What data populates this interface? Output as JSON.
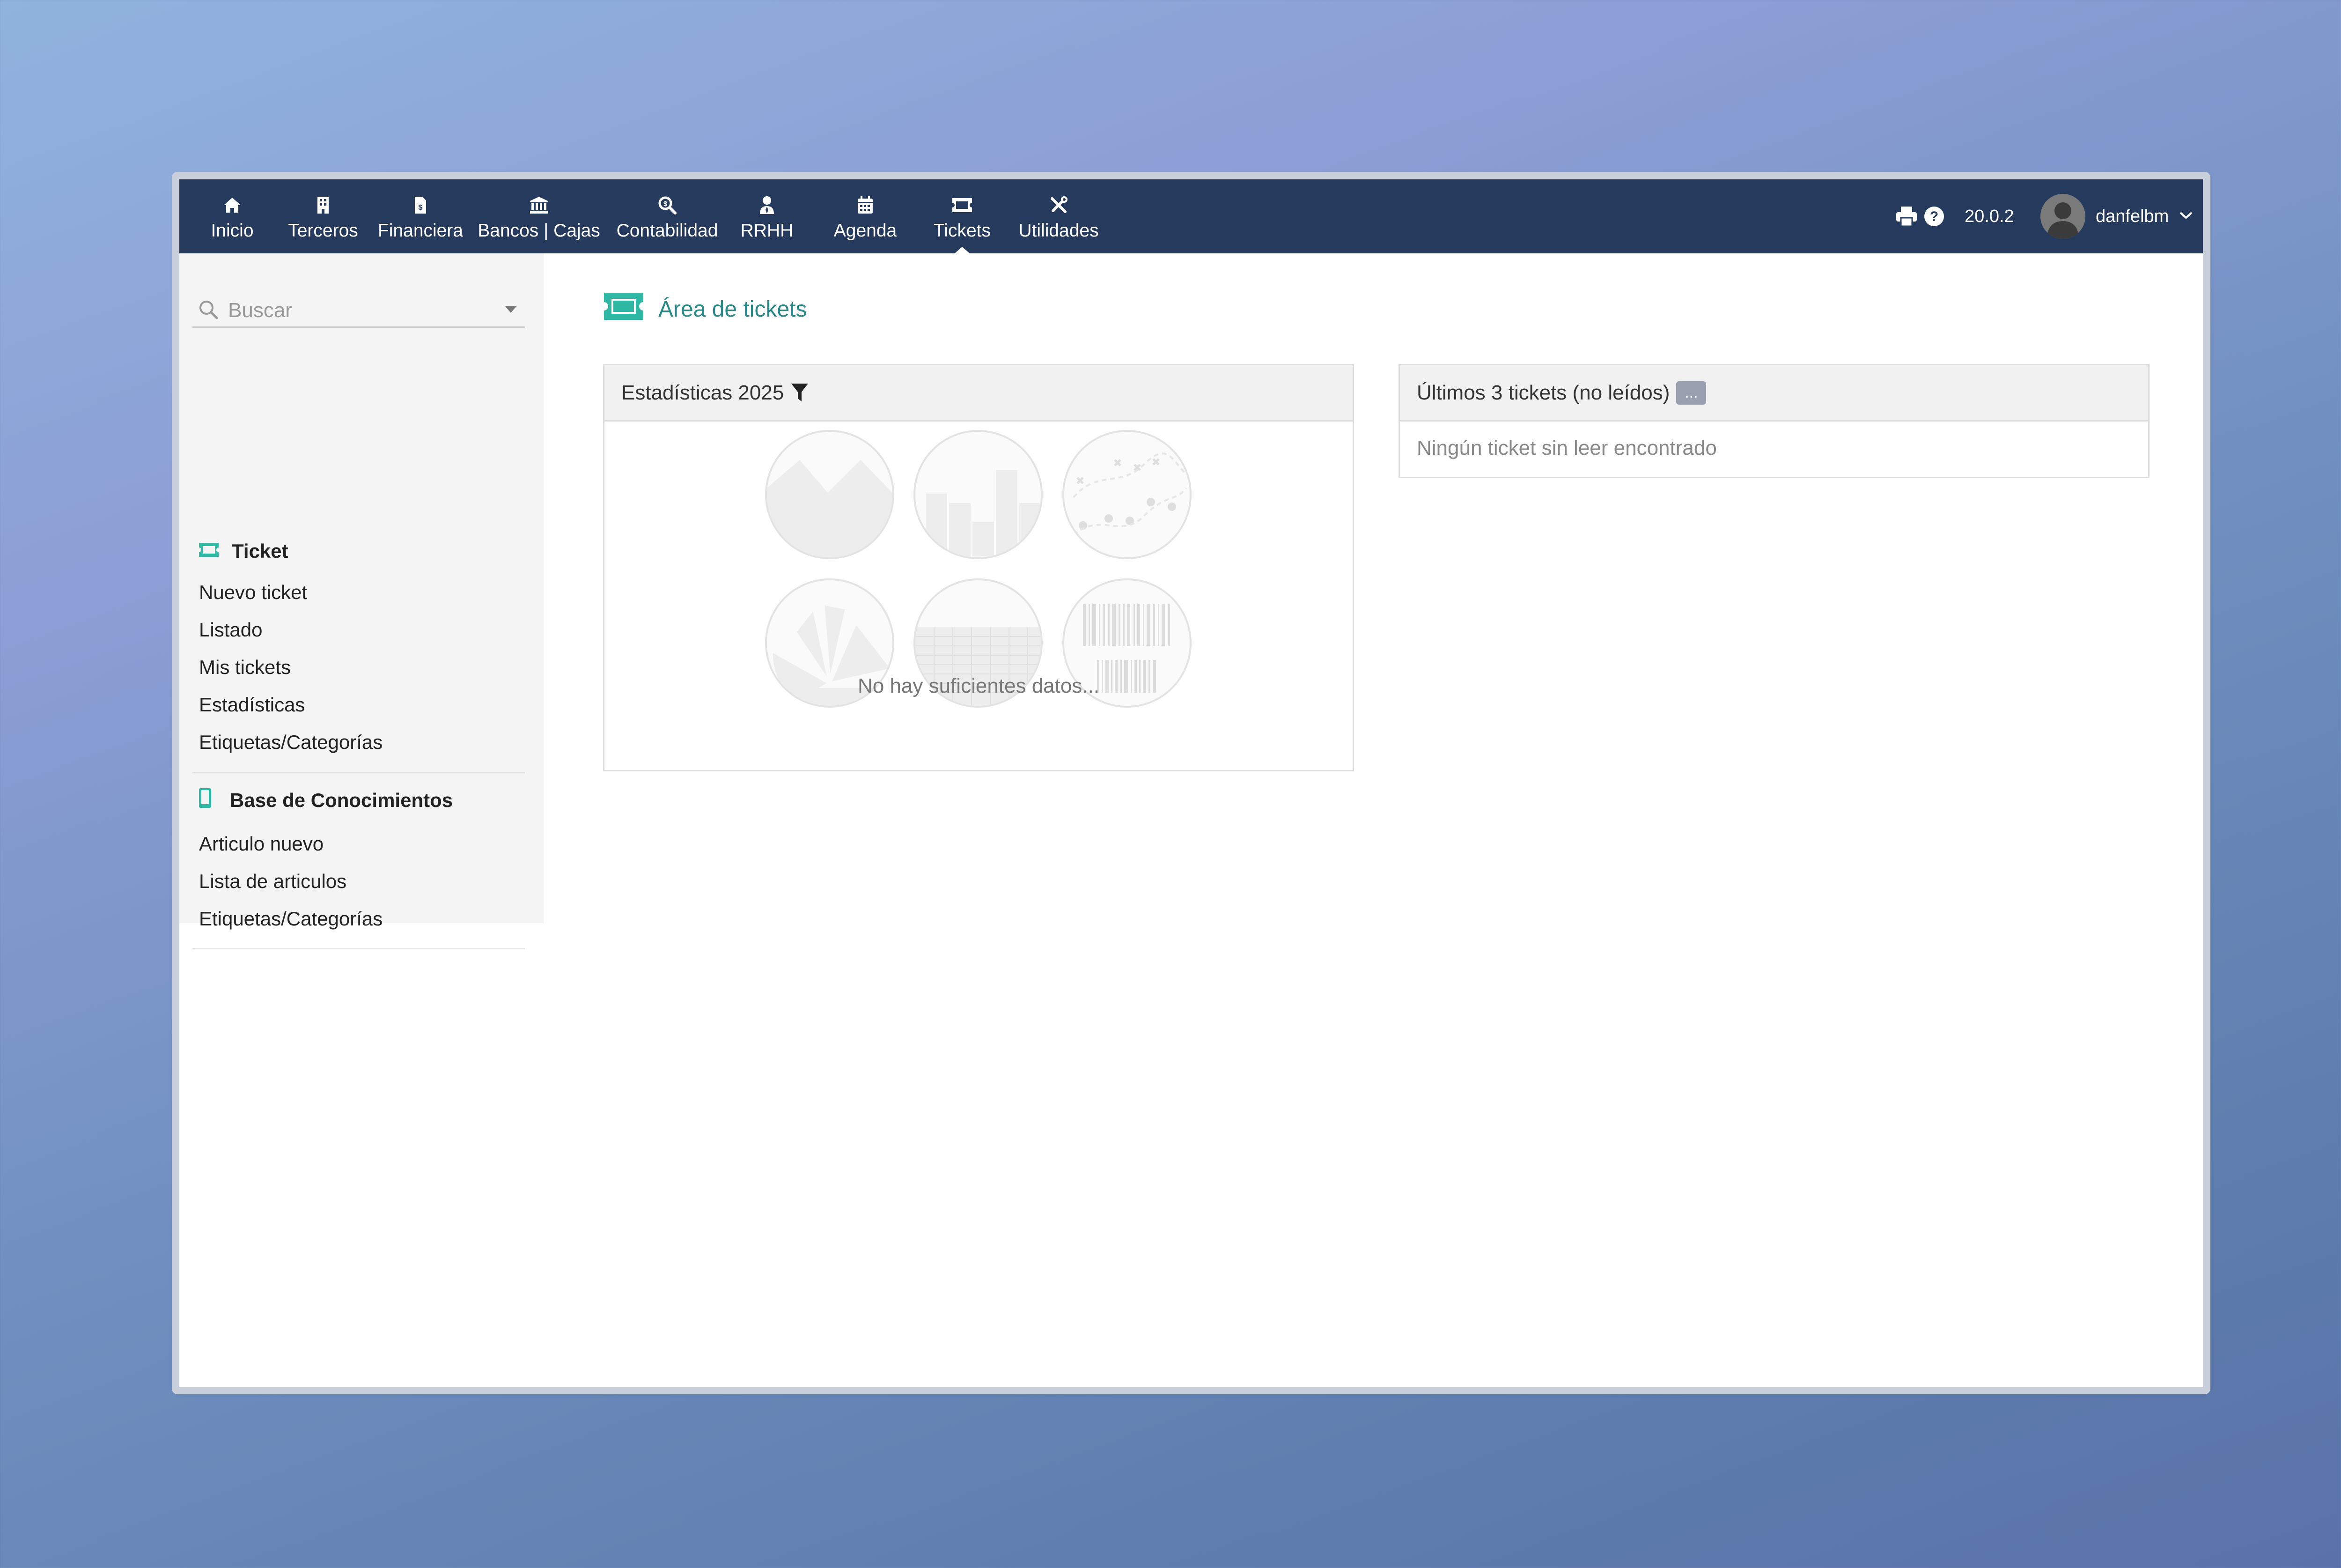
{
  "nav": {
    "items": [
      {
        "label": "Inicio",
        "icon": "home-icon"
      },
      {
        "label": "Terceros",
        "icon": "building-icon"
      },
      {
        "label": "Financiera",
        "icon": "invoice-icon"
      },
      {
        "label": "Bancos | Cajas",
        "icon": "bank-icon"
      },
      {
        "label": "Contabilidad",
        "icon": "search-dollar-icon"
      },
      {
        "label": "RRHH",
        "icon": "user-tie-icon"
      },
      {
        "label": "Agenda",
        "icon": "calendar-icon"
      },
      {
        "label": "Tickets",
        "icon": "ticket-icon"
      },
      {
        "label": "Utilidades",
        "icon": "tools-icon"
      }
    ],
    "active": "Tickets",
    "version": "20.0.2",
    "user": "danfelbm"
  },
  "sidebar": {
    "search_placeholder": "Buscar",
    "sections": [
      {
        "title": "Ticket",
        "icon": "ticket-icon",
        "items": [
          "Nuevo ticket",
          "Listado",
          "Mis tickets",
          "Estadísticas",
          "Etiquetas/Categorías"
        ]
      },
      {
        "title": "Base de Conocimientos",
        "icon": "book-icon",
        "items": [
          "Articulo nuevo",
          "Lista de articulos",
          "Etiquetas/Categorías"
        ]
      }
    ]
  },
  "main": {
    "title": "Área de tickets",
    "stats_panel": {
      "title": "Estadísticas 2025",
      "no_data": "No hay suficientes datos..."
    },
    "latest_panel": {
      "title": "Últimos 3 tickets (no leídos)",
      "more_label": "...",
      "empty": "Ningún ticket sin leer encontrado"
    }
  },
  "colors": {
    "topbar": "#263a5e",
    "accent": "#2fb9a5",
    "title_teal": "#268a8a"
  }
}
